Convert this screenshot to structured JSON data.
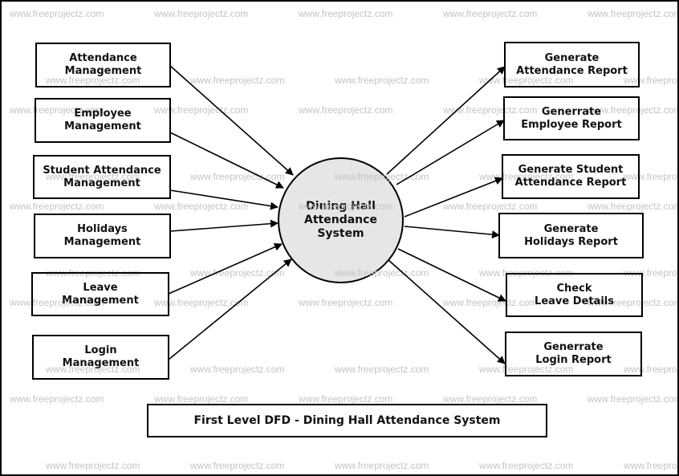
{
  "diagram": {
    "type": "Data Flow Diagram",
    "title": "First Level DFD - Dining Hall Attendance System",
    "process": "Dining Hall\nAttendance\nSystem",
    "inputs": [
      "Attendance\nManagement",
      "Employee\nManagement",
      "Student Attendance\nManagement",
      "Holidays\nManagement",
      "Leave\nManagement",
      "Login\nManagement"
    ],
    "outputs": [
      "Generate\nAttendance Report",
      "Generrate\nEmployee Report",
      "Generate Student\nAttendance Report",
      "Generate\nHolidays Report",
      "Check\nLeave Details",
      "Generrate\nLogin Report"
    ],
    "watermark": "www.freeprojectz.com"
  }
}
